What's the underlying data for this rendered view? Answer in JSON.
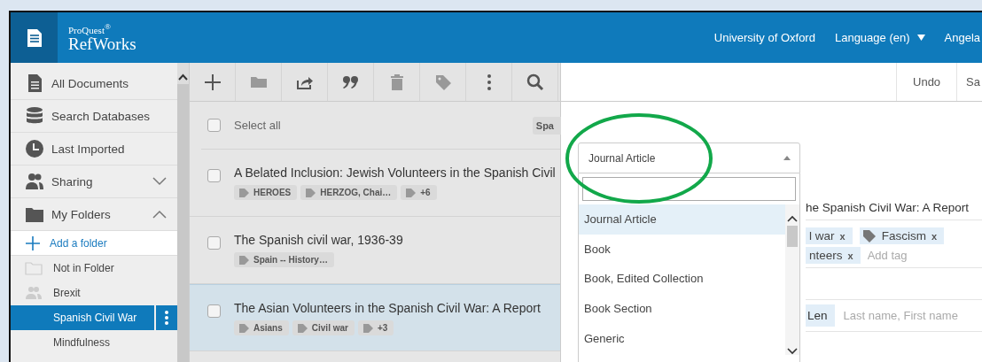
{
  "header": {
    "brand_small": "ProQuest$^{®}$",
    "brand": "RefWorks",
    "links": [
      {
        "label": "University of Oxford",
        "dropdown": false
      },
      {
        "label": "Language (en)",
        "dropdown": true
      },
      {
        "label": "Angela",
        "dropdown": false
      }
    ]
  },
  "sidebar": {
    "items": [
      {
        "label": "All Documents"
      },
      {
        "label": "Search Databases"
      },
      {
        "label": "Last Imported"
      },
      {
        "label": "Sharing",
        "expanded": false
      },
      {
        "label": "My Folders",
        "expanded": true
      }
    ],
    "add_folder": "Add a folder",
    "folders": [
      {
        "label": "Not in Folder",
        "selected": false
      },
      {
        "label": "Brexit",
        "selected": false
      },
      {
        "label": "Spanish Civil War",
        "selected": true
      },
      {
        "label": "Mindfulness",
        "selected": false
      }
    ]
  },
  "list": {
    "select_all": {
      "label": "Select all",
      "checked": false
    },
    "filter_chip": "Spa",
    "rows": [
      {
        "title": "A Belated Inclusion: Jewish Volunteers in the Spanish Civil",
        "tags": [
          "HEROES",
          "HERZOG, Chai…",
          "+6"
        ],
        "selected": false,
        "checked": false
      },
      {
        "title": "The Spanish civil war, 1936-39",
        "tags": [
          "Spain -- History…"
        ],
        "selected": false,
        "checked": false
      },
      {
        "title": "The Asian Volunteers in the Spanish Civil War: A Report",
        "tags": [
          "Asians",
          "Civil war",
          "+3"
        ],
        "selected": true,
        "checked": false
      }
    ]
  },
  "editor": {
    "actions": [
      "Undo",
      "Sa"
    ],
    "title_fragment": "he Spanish Civil War: A Report",
    "tags": [
      {
        "label": "l war",
        "icon": false,
        "remove": "x"
      },
      {
        "label": "Fascism",
        "icon": true,
        "remove": "x"
      }
    ],
    "tags_line2": [
      {
        "label": "nteers",
        "icon": false,
        "remove": "x"
      }
    ],
    "add_tag": {
      "placeholder": "Add tag"
    },
    "author_chip": "Len",
    "author_field": {
      "placeholder": "Last name, First name"
    },
    "type_select": {
      "value": "Journal Article",
      "expanded": true,
      "options": [
        {
          "label": "Journal Article",
          "selected": true
        },
        {
          "label": "Book",
          "selected": false
        },
        {
          "label": "Book, Edited Collection",
          "selected": false
        },
        {
          "label": "Book Section",
          "selected": false
        },
        {
          "label": "Generic",
          "selected": false
        }
      ]
    }
  }
}
